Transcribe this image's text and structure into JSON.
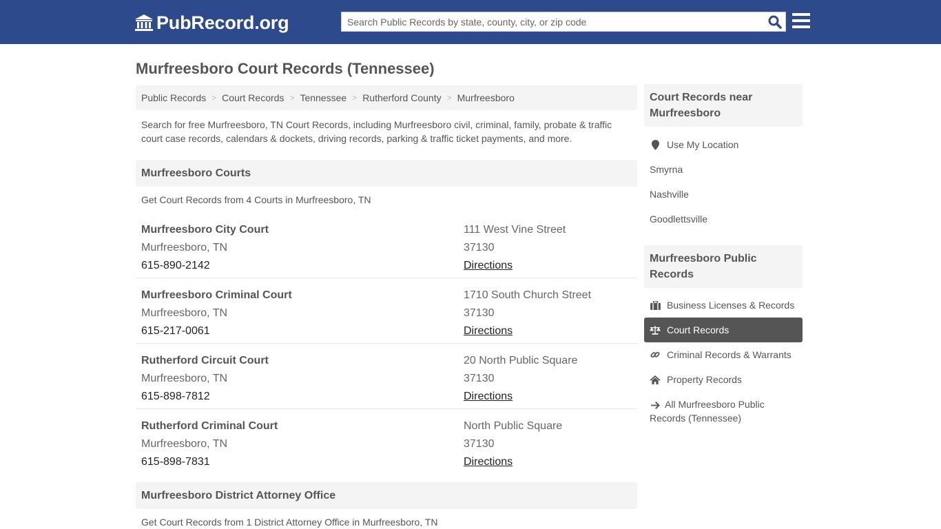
{
  "header": {
    "logo_text": "PubRecord.org",
    "search_placeholder": "Search Public Records by state, county, city, or zip code",
    "brand_color": "#2d4a8d"
  },
  "page": {
    "title": "Murfreesboro Court Records (Tennessee)",
    "breadcrumb": [
      "Public Records",
      "Court Records",
      "Tennessee",
      "Rutherford County",
      "Murfreesboro"
    ],
    "intro": "Search for free Murfreesboro, TN Court Records, including Murfreesboro civil, criminal, family, probate & traffic court case records, calendars & dockets, driving records, parking & traffic ticket payments, and more."
  },
  "courts_section": {
    "heading": "Murfreesboro Courts",
    "subtitle": "Get Court Records from 4 Courts in Murfreesboro, TN",
    "courts": [
      {
        "name": "Murfreesboro City Court",
        "city": "Murfreesboro, TN",
        "phone": "615-890-2142",
        "address": "111 West Vine Street",
        "zip": "37130",
        "directions": "Directions"
      },
      {
        "name": "Murfreesboro Criminal Court",
        "city": "Murfreesboro, TN",
        "phone": "615-217-0061",
        "address": "1710 South Church Street",
        "zip": "37130",
        "directions": "Directions"
      },
      {
        "name": "Rutherford Circuit Court",
        "city": "Murfreesboro, TN",
        "phone": "615-898-7812",
        "address": "20 North Public Square",
        "zip": "37130",
        "directions": "Directions"
      },
      {
        "name": "Rutherford Criminal Court",
        "city": "Murfreesboro, TN",
        "phone": "615-898-7831",
        "address": "North Public Square",
        "zip": "37130",
        "directions": "Directions"
      }
    ]
  },
  "da_section": {
    "heading": "Murfreesboro District Attorney Office",
    "subtitle": "Get Court Records from 1 District Attorney Office in Murfreesboro, TN"
  },
  "sidebar": {
    "nearby": {
      "heading": "Court Records near Murfreesboro",
      "use_location": "Use My Location",
      "cities": [
        "Smyrna",
        "Nashville",
        "Goodlettsville"
      ]
    },
    "public_records": {
      "heading": "Murfreesboro Public Records",
      "items": [
        {
          "label": "Business Licenses & Records",
          "icon": "briefcase-icon"
        },
        {
          "label": "Court Records",
          "icon": "scales-icon",
          "active": true
        },
        {
          "label": "Criminal Records & Warrants",
          "icon": "link-icon"
        },
        {
          "label": "Property Records",
          "icon": "home-icon"
        }
      ],
      "all_link": "All Murfreesboro Public Records (Tennessee)"
    }
  }
}
